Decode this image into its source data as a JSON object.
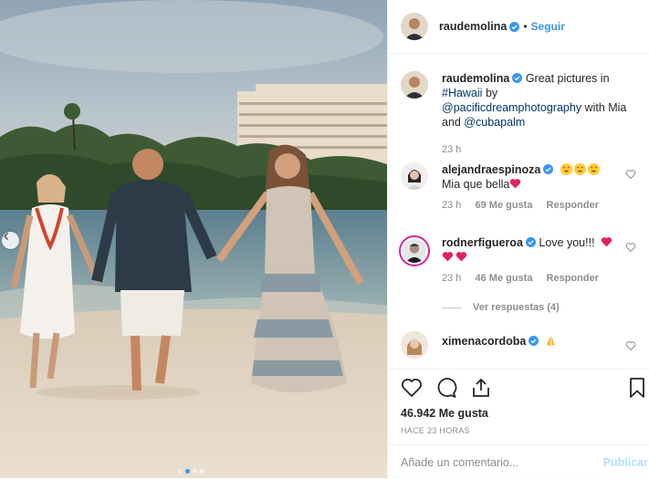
{
  "post": {
    "author": "raudemolina",
    "follow_label": "Seguir"
  },
  "caption": {
    "username": "raudemolina",
    "text_before": "Great pictures in ",
    "hashtag": "#Hawaii",
    "text_mid": " by ",
    "mention1": "@pacificdreamphotography",
    "text_mid2": " with Mia and ",
    "mention2": "@cubapalm",
    "time": "23 h"
  },
  "comments": [
    {
      "username": "alejandraespinoza",
      "text": "Mia que bella",
      "time": "23 h",
      "likes": "69 Me gusta",
      "reply_label": "Responder"
    },
    {
      "username": "rodnerfigueroa",
      "text": "Love you!!!",
      "time": "23 h",
      "likes": "46 Me gusta",
      "reply_label": "Responder",
      "view_replies": "Ver respuestas (4)"
    },
    {
      "username": "ximenacordoba",
      "text": ""
    }
  ],
  "actions": {
    "likes_count": "46.942 Me gusta",
    "timestamp": "HACE 23 HORAS"
  },
  "comment_box": {
    "placeholder": "Añade un comentario...",
    "publish_label": "Publicar"
  },
  "carousel": {
    "dot_count": 4,
    "active_index": 1
  },
  "colors": {
    "link_blue": "#3897f0",
    "mention": "#00376b",
    "heart_red": "#ed4956",
    "verified": "#3897f0"
  }
}
